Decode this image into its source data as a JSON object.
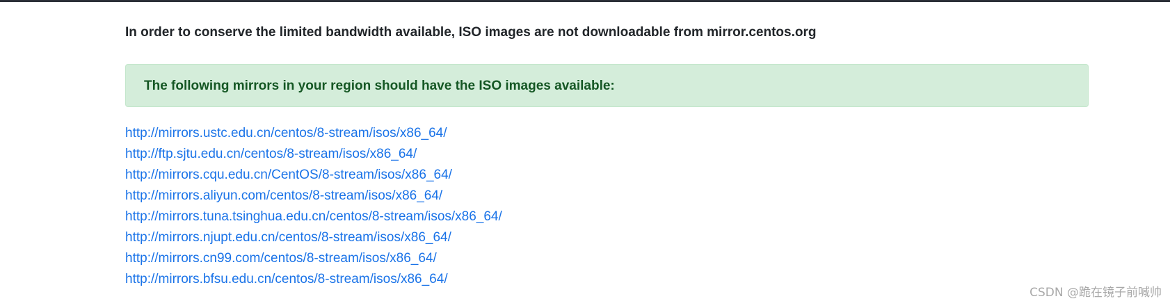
{
  "notice": {
    "text": "In order to conserve the limited bandwidth available, ISO images are not downloadable from mirror.centos.org"
  },
  "alert": {
    "text": "The following mirrors in your region should have the ISO images available:",
    "background_color": "#d4edda",
    "text_color": "#155724"
  },
  "mirrors": [
    "http://mirrors.ustc.edu.cn/centos/8-stream/isos/x86_64/",
    "http://ftp.sjtu.edu.cn/centos/8-stream/isos/x86_64/",
    "http://mirrors.cqu.edu.cn/CentOS/8-stream/isos/x86_64/",
    "http://mirrors.aliyun.com/centos/8-stream/isos/x86_64/",
    "http://mirrors.tuna.tsinghua.edu.cn/centos/8-stream/isos/x86_64/",
    "http://mirrors.njupt.edu.cn/centos/8-stream/isos/x86_64/",
    "http://mirrors.cn99.com/centos/8-stream/isos/x86_64/",
    "http://mirrors.bfsu.edu.cn/centos/8-stream/isos/x86_64/"
  ],
  "link_color": "#1a73e8",
  "watermark": {
    "text": "CSDN @跪在镜子前喊帅"
  }
}
